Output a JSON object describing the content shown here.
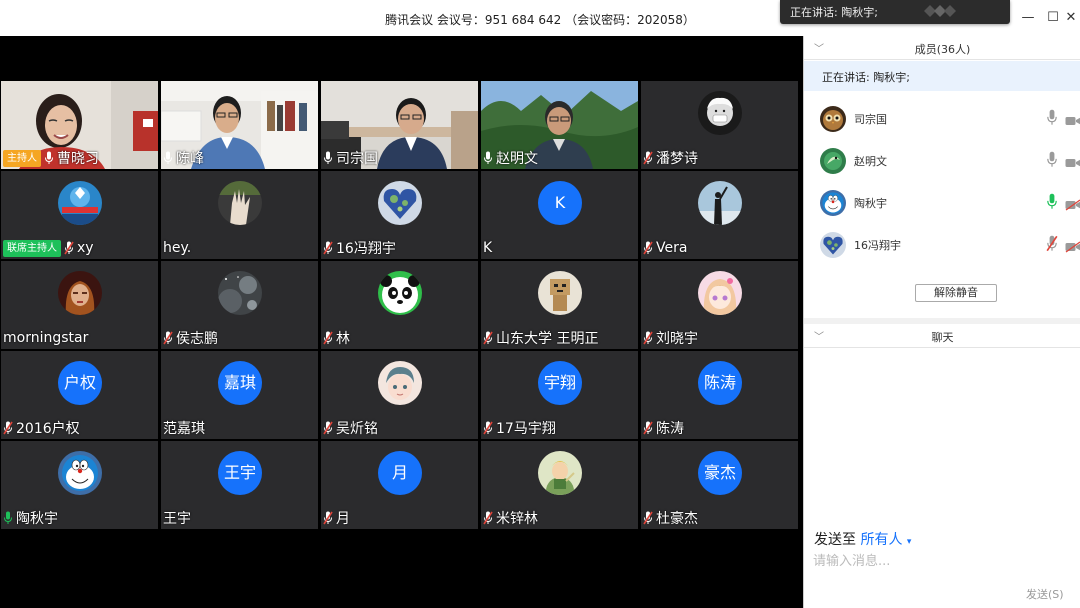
{
  "window": {
    "title": "腾讯会议 会议号：951 684 642  （会议密码：202058）",
    "minimize": "—",
    "maximize": "☐",
    "close": "✕"
  },
  "toast": {
    "text": "正在讲话: 陶秋宇;"
  },
  "tiles": [
    {
      "name": "曹晓习",
      "role": "主持人",
      "mic": "on",
      "kind": "photo",
      "scene": "woman-red"
    },
    {
      "name": "陈峰",
      "mic": "on",
      "kind": "photo",
      "scene": "man-office"
    },
    {
      "name": "司宗国",
      "mic": "on",
      "kind": "photo",
      "scene": "man-desk"
    },
    {
      "name": "赵明文",
      "mic": "on",
      "kind": "photo",
      "scene": "man-mountains"
    },
    {
      "name": "潘梦诗",
      "mic": "muted",
      "kind": "avatar",
      "avatar": "einstein"
    },
    {
      "name": "xy",
      "role": "联席主持人",
      "mic": "muted",
      "kind": "avatar",
      "avatar": "badge-blue"
    },
    {
      "name": "hey.",
      "mic": "none",
      "kind": "avatar",
      "avatar": "hand"
    },
    {
      "name": "16冯翔宇",
      "mic": "muted",
      "kind": "avatar",
      "avatar": "heart-earth"
    },
    {
      "name": "K",
      "mic": "none",
      "kind": "initial",
      "initial": "K"
    },
    {
      "name": "Vera",
      "mic": "muted",
      "kind": "avatar",
      "avatar": "silhouette"
    },
    {
      "name": "morningstar",
      "mic": "none",
      "kind": "avatar",
      "avatar": "portrait-red"
    },
    {
      "name": "侯志鹏",
      "mic": "muted",
      "kind": "avatar",
      "avatar": "space"
    },
    {
      "name": "林",
      "mic": "muted",
      "kind": "avatar",
      "avatar": "panda"
    },
    {
      "name": "山东大学  王明正",
      "mic": "muted",
      "kind": "avatar",
      "avatar": "cardboard"
    },
    {
      "name": "刘晓宇",
      "mic": "muted",
      "kind": "avatar",
      "avatar": "anime-girl"
    },
    {
      "name": "2016户权",
      "mic": "muted",
      "kind": "initial",
      "initial": "户权"
    },
    {
      "name": "范嘉琪",
      "mic": "none",
      "kind": "initial",
      "initial": "嘉琪"
    },
    {
      "name": "吴炘铭",
      "mic": "muted",
      "kind": "avatar",
      "avatar": "anime-boy"
    },
    {
      "name": "17马宇翔",
      "mic": "muted",
      "kind": "initial",
      "initial": "宇翔"
    },
    {
      "name": "陈涛",
      "mic": "muted",
      "kind": "initial",
      "initial": "陈涛"
    },
    {
      "name": "陶秋宇",
      "mic": "active",
      "kind": "avatar",
      "avatar": "doraemon"
    },
    {
      "name": "王宇",
      "mic": "none",
      "kind": "initial",
      "initial": "王宇"
    },
    {
      "name": "月",
      "mic": "muted",
      "kind": "initial",
      "initial": "月"
    },
    {
      "name": "米锌林",
      "mic": "muted",
      "kind": "avatar",
      "avatar": "little-prince"
    },
    {
      "name": "杜豪杰",
      "mic": "muted",
      "kind": "initial",
      "initial": "豪杰"
    }
  ],
  "panel": {
    "members_header": "成员(36人)",
    "now_speaking": "正在讲话: 陶秋宇;",
    "members": [
      {
        "name": "司宗国",
        "mic": "on",
        "cam": "on",
        "avatar": "owl"
      },
      {
        "name": "赵明文",
        "mic": "on",
        "cam": "on",
        "avatar": "green-bird"
      },
      {
        "name": "陶秋宇",
        "mic": "active",
        "cam": "off",
        "avatar": "doraemon"
      },
      {
        "name": "16冯翔宇",
        "mic": "muted",
        "cam": "off",
        "avatar": "heart-earth"
      }
    ],
    "unmute_button": "解除静音",
    "chat_header": "聊天",
    "send_to_label": "发送至",
    "send_to_value": "所有人",
    "input_placeholder": "请输入消息...",
    "send_button": "发送(S)"
  },
  "colors": {
    "accent": "#1672fb",
    "tile_bg": "#2b2b2d",
    "host_tag": "#f5a623",
    "cohost_tag": "#1ec05a",
    "mic_active": "#1ec05a",
    "mic_muted": "#e0443a"
  }
}
